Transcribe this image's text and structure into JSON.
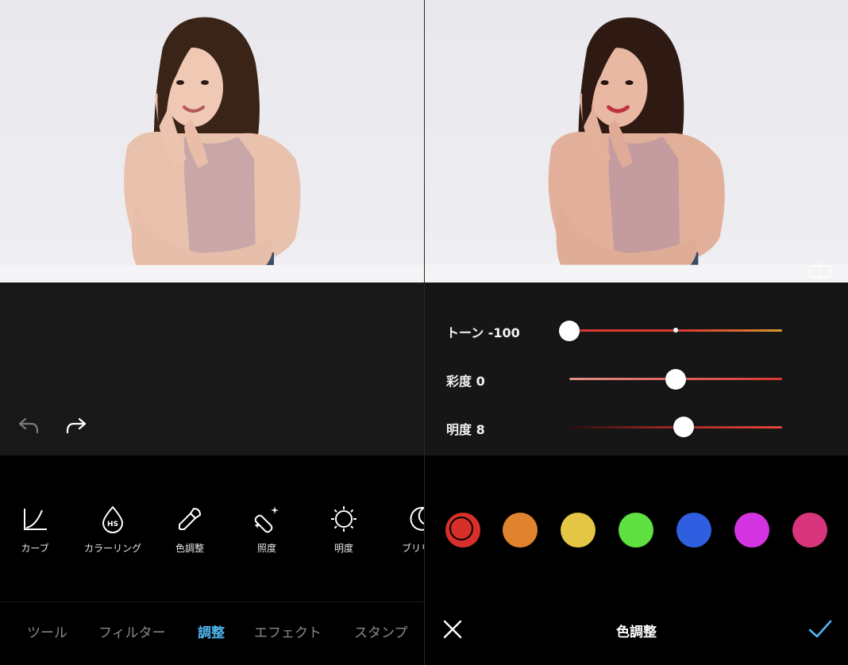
{
  "left": {
    "tools": [
      {
        "label": "カーブ",
        "icon": "curve-icon"
      },
      {
        "label": "カラーリング",
        "icon": "hs-droplet-icon"
      },
      {
        "label": "色調整",
        "icon": "eyedropper-icon"
      },
      {
        "label": "照度",
        "icon": "sparkle-pen-icon"
      },
      {
        "label": "明度",
        "icon": "sun-icon"
      },
      {
        "label": "ブリリア",
        "icon": "moon-icon"
      }
    ],
    "tabs": [
      {
        "label": "ツール",
        "active": false
      },
      {
        "label": "フィルター",
        "active": false
      },
      {
        "label": "調整",
        "active": true
      },
      {
        "label": "エフェクト",
        "active": false
      },
      {
        "label": "スタンプ",
        "active": false
      }
    ]
  },
  "right": {
    "sliders": [
      {
        "label": "トーン -100",
        "value": -100,
        "min": -100,
        "max": 100
      },
      {
        "label": "彩度 0",
        "value": 0,
        "min": -100,
        "max": 100
      },
      {
        "label": "明度 8",
        "value": 8,
        "min": -100,
        "max": 100
      }
    ],
    "swatches": [
      {
        "name": "red",
        "color": "#d7302b",
        "selected": true
      },
      {
        "name": "orange",
        "color": "#e0832f",
        "selected": false
      },
      {
        "name": "yellow",
        "color": "#e2c644",
        "selected": false
      },
      {
        "name": "green",
        "color": "#5ee040",
        "selected": false
      },
      {
        "name": "blue",
        "color": "#2f5fe0",
        "selected": false
      },
      {
        "name": "magenta",
        "color": "#d433e2",
        "selected": false
      },
      {
        "name": "pink",
        "color": "#d9357d",
        "selected": false
      }
    ],
    "bottom_title": "色調整"
  },
  "colors": {
    "accent": "#4fb7f0",
    "panel_bg": "#161616",
    "slider_red": "#d8372f"
  }
}
